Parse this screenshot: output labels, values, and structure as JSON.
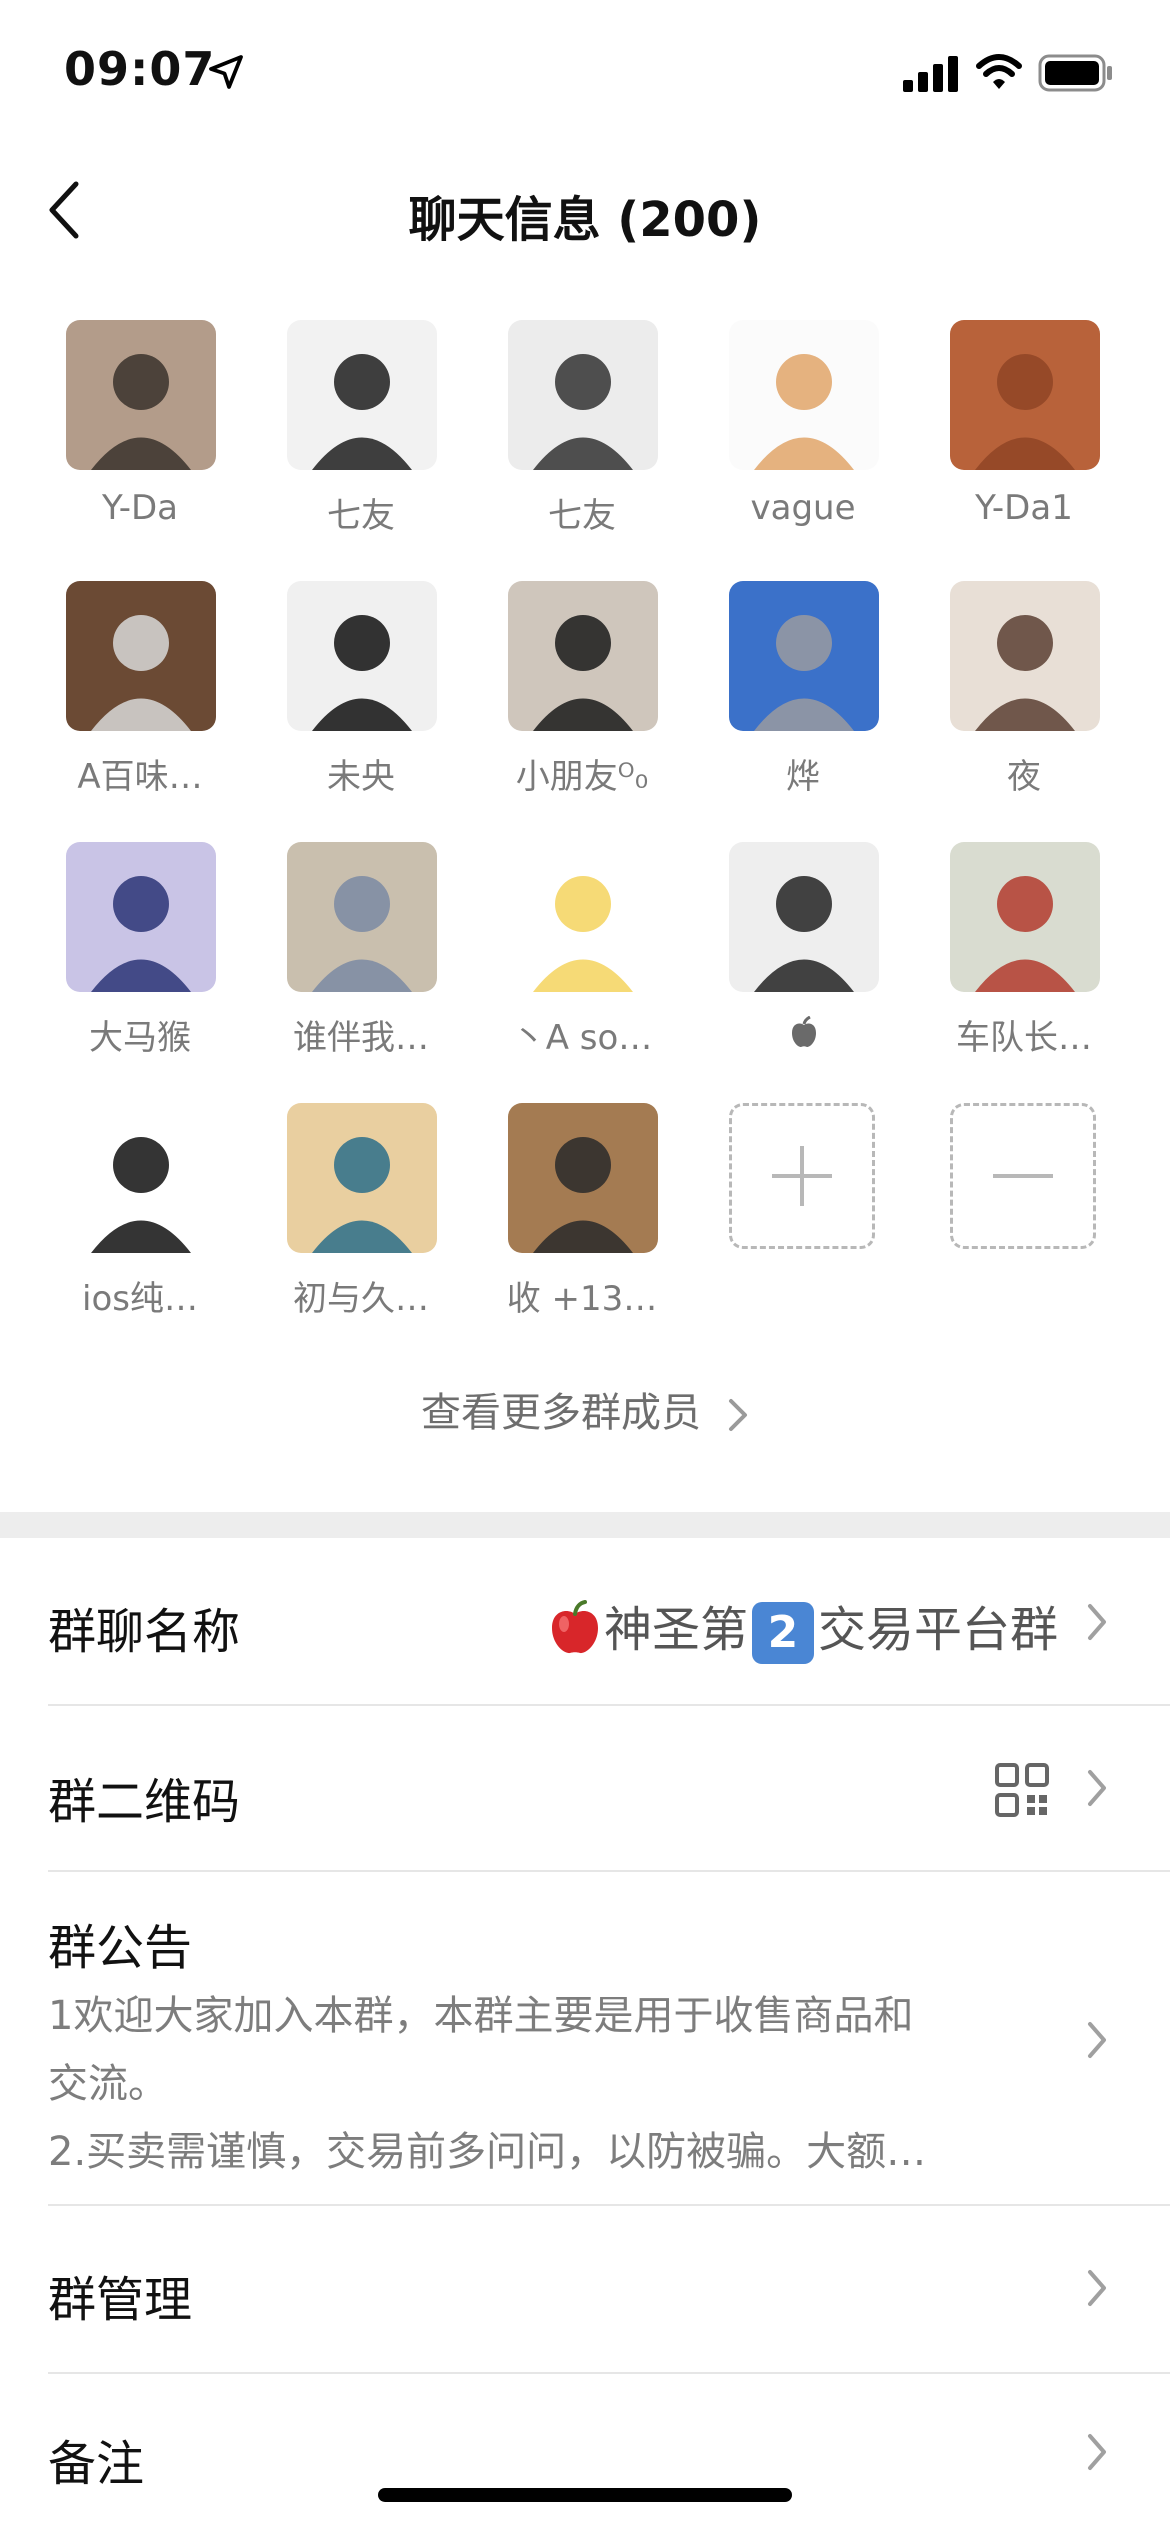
{
  "status_bar": {
    "time": "09:07"
  },
  "nav": {
    "title": "聊天信息 (200)"
  },
  "members": [
    {
      "name": "Y-Da",
      "color1": "#b39c8a",
      "color2": "#3a322c"
    },
    {
      "name": "七友",
      "color1": "#f2f2f2",
      "color2": "#1e1e1e"
    },
    {
      "name": "七友",
      "color1": "#ececec",
      "color2": "#333333"
    },
    {
      "name": "vague",
      "color1": "#fbfbfb",
      "color2": "#e1a468"
    },
    {
      "name": "Y-Da1",
      "color1": "#b8623a",
      "color2": "#8f4526"
    },
    {
      "name": "A百味…",
      "color1": "#6b4a34",
      "color2": "#d8d8d8"
    },
    {
      "name": "未央",
      "color1": "#f0f0f0",
      "color2": "#111111"
    },
    {
      "name": "小朋友ᴼ₀",
      "color1": "#cfc6bc",
      "color2": "#1a1a1a"
    },
    {
      "name": "烨",
      "color1": "#3b71c9",
      "color2": "#9a9aa0"
    },
    {
      "name": "夜",
      "color1": "#e8dfd6",
      "color2": "#5a4032"
    },
    {
      "name": "大马猴",
      "color1": "#c9c4e6",
      "color2": "#2c3576"
    },
    {
      "name": "谁伴我…",
      "color1": "#c9bfae",
      "color2": "#7b8aa3"
    },
    {
      "name": "丶A so…",
      "color1": "#ffffff",
      "color2": "#f4d35e"
    },
    {
      "name": "",
      "color1": "#eeeeee",
      "color2": "#222222"
    },
    {
      "name": "车队长…",
      "color1": "#d9dcd0",
      "color2": "#b23b2e"
    },
    {
      "name": "ios纯…",
      "color1": "#ffffff",
      "color2": "#111111"
    },
    {
      "name": "初与久…",
      "color1": "#e9cfa0",
      "color2": "#2b6f8a"
    },
    {
      "name": "收 +13…",
      "color1": "#a47b52",
      "color2": "#2a2a2a"
    }
  ],
  "add_button_label": "+",
  "remove_button_label": "−",
  "more_members": "查看更多群成员",
  "settings": {
    "group_name_label": "群聊名称",
    "group_name_value_a": "神圣第",
    "group_name_badge": "2",
    "group_name_value_b": "交易平台群",
    "qr_label": "群二维码",
    "notice_label": "群公告",
    "notice_line1": "1欢迎大家加入本群，本群主要是用于收售商品和",
    "notice_line2": "交流。",
    "notice_line3": "2.买卖需谨慎，交易前多问问，以防被骗。大额…",
    "manage_label": "群管理",
    "remark_label": "备注"
  },
  "colors": {
    "accent_badge": "#4a86d4",
    "separator": "#ededed"
  }
}
